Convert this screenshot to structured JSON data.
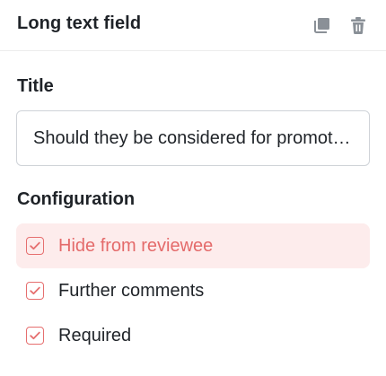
{
  "header": {
    "title": "Long text field",
    "icons": [
      "copy-icon",
      "trash-icon"
    ]
  },
  "title_section": {
    "label": "Title",
    "value": "Should they be considered for promotion?"
  },
  "config_section": {
    "label": "Configuration",
    "options": [
      {
        "label": "Hide from reviewee",
        "checked": true,
        "highlighted": true
      },
      {
        "label": "Further comments",
        "checked": true,
        "highlighted": false
      },
      {
        "label": "Required",
        "checked": true,
        "highlighted": false
      }
    ]
  },
  "colors": {
    "accent": "#e66f6f",
    "highlight_bg": "#fdecec",
    "icon_gray": "#8a9097"
  }
}
